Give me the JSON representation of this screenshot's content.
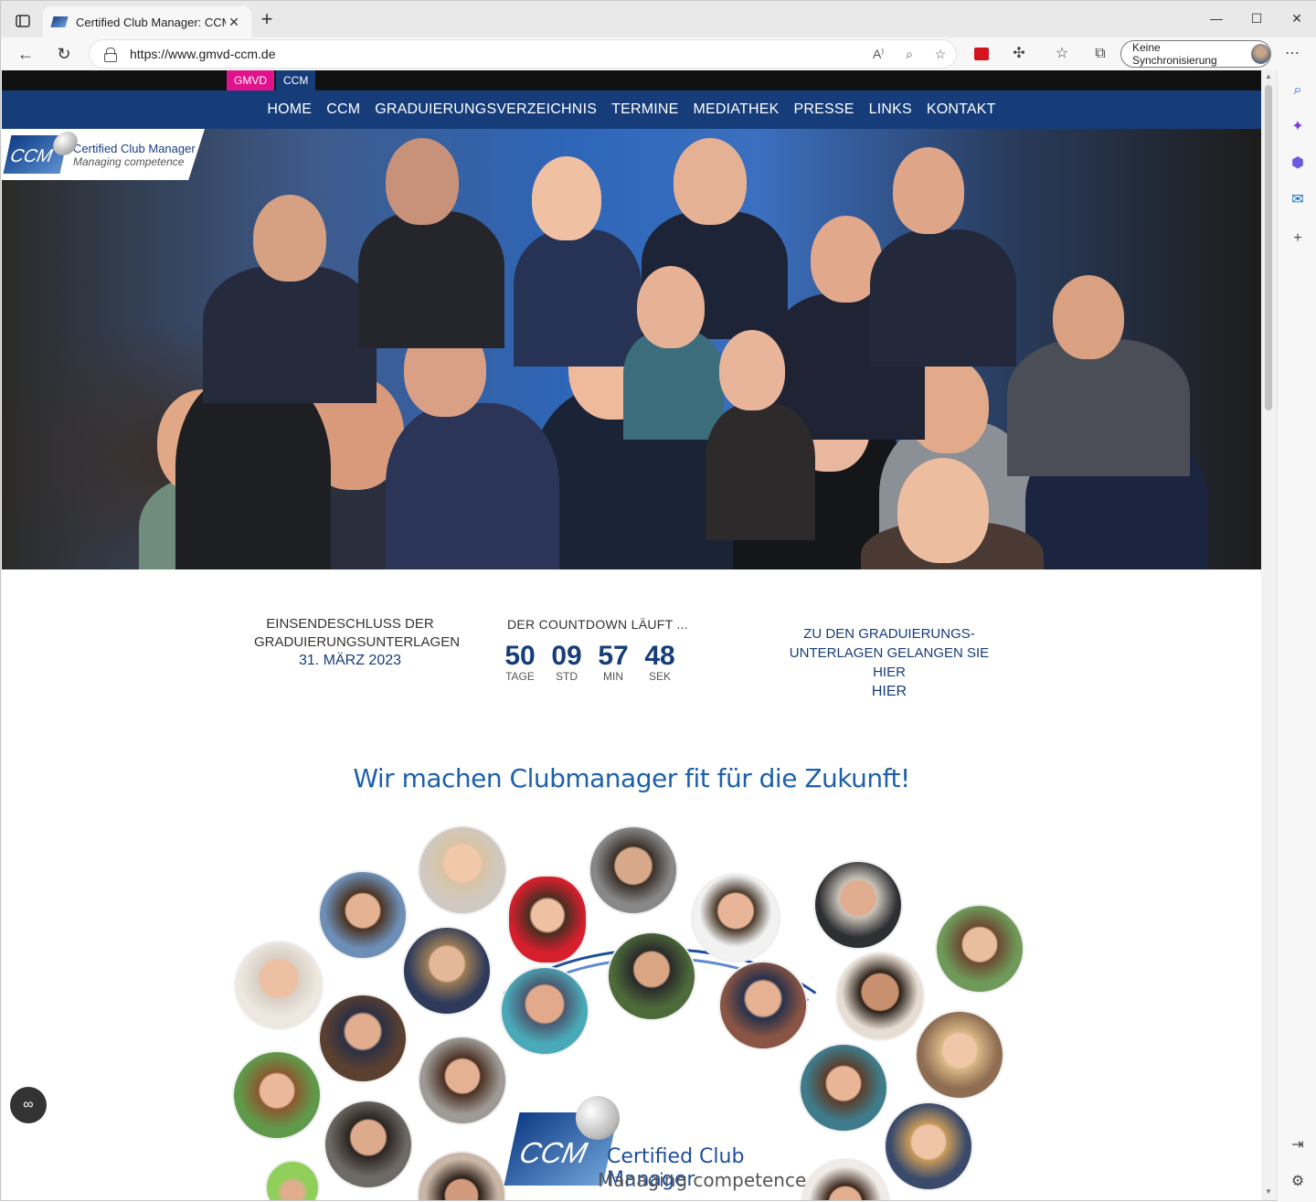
{
  "browser": {
    "tab_title": "Certified Club Manager: CCM",
    "tab_close": "✕",
    "new_tab": "+",
    "url": "https://www.gmvd-ccm.de",
    "sync_label": "Keine Synchronisierung",
    "controls": {
      "minimize": "—",
      "maximize": "☐",
      "close": "✕"
    }
  },
  "site": {
    "top_tabs": [
      "GMVD",
      "CCM"
    ],
    "nav": [
      "HOME",
      "CCM",
      "GRADUIERUNGSVERZEICHNIS",
      "TERMINE",
      "MEDIATHEK",
      "PRESSE",
      "LINKS",
      "KONTAKT"
    ],
    "hero_logo": {
      "mark": "CCM",
      "line1": "Certified Club Manager",
      "line2": "Managing competence"
    },
    "deadline": {
      "line1": "EINSENDESCHLUSS DER",
      "line2": "GRADUIERUNGSUNTERLAGEN",
      "date": "31. MÄRZ 2023"
    },
    "countdown": {
      "title": "DER COUNTDOWN LÄUFT ...",
      "units": [
        {
          "value": "50",
          "label": "TAGE"
        },
        {
          "value": "09",
          "label": "STD"
        },
        {
          "value": "57",
          "label": "MIN"
        },
        {
          "value": "48",
          "label": "SEK"
        }
      ]
    },
    "docs_link": {
      "line1": "ZU DEN GRADUIERUNGS-",
      "line2": "UNTERLAGEN GELANGEN SIE HIER",
      "link": "HIER"
    },
    "headline": "Wir machen Clubmanager fit für die Zukunft!",
    "footer_logo": {
      "mark": "CCM",
      "line1": "Certified Club Manager",
      "line2": "Managing competence"
    }
  },
  "colors": {
    "nav_bg": "#163d7a",
    "gmvd_pink": "#e0138c",
    "headline_blue": "#1d60ad"
  }
}
